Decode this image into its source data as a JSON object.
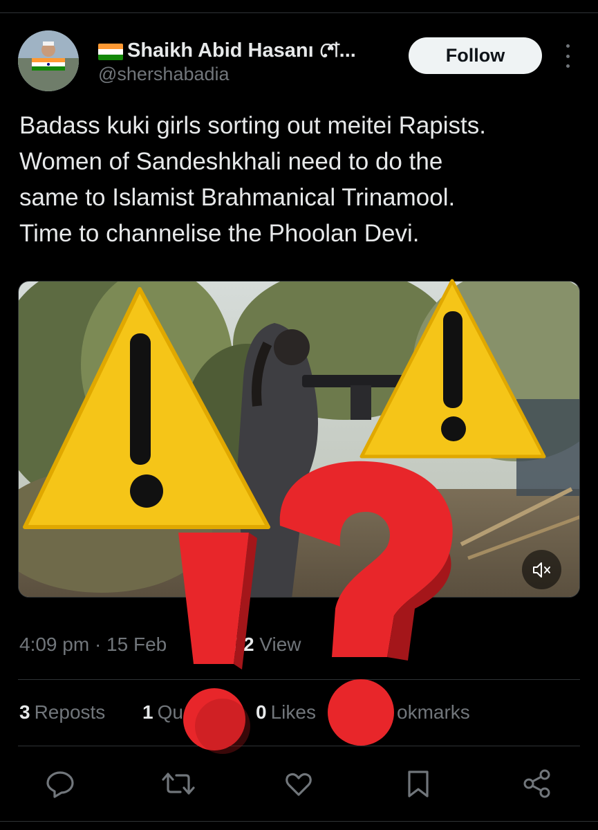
{
  "author": {
    "display_name": "Shaikh Abid Hasanı শে...",
    "handle": "@shershabadia",
    "follow_label": "Follow",
    "flag_colors": [
      "#ff9933",
      "#ffffff",
      "#138808"
    ]
  },
  "tweet": {
    "lines": [
      "Badass kuki girls sorting out meitei Rapists.",
      "Women of Sandeshkhali need to do the",
      "same to Islamist Brahmanical Trinamool.",
      "Time to channelise the Phoolan Devi."
    ]
  },
  "media": {
    "mute_icon": "volume-mute-icon"
  },
  "meta": {
    "time": "4:09 pm · 15 Feb",
    "views_count": "522",
    "views_label": "View"
  },
  "stats": {
    "reposts_count": "3",
    "reposts_label": "Reposts",
    "quotes_count": "1",
    "quotes_label": "Qu",
    "likes_count": "0",
    "likes_label": "Likes",
    "bookmarks_label": "okmarks"
  },
  "actions": [
    "reply-icon",
    "repost-icon",
    "like-icon",
    "bookmark-icon",
    "share-icon"
  ],
  "overlay": {
    "warning_color": "#f5c518",
    "question_color": "#e8262a"
  }
}
